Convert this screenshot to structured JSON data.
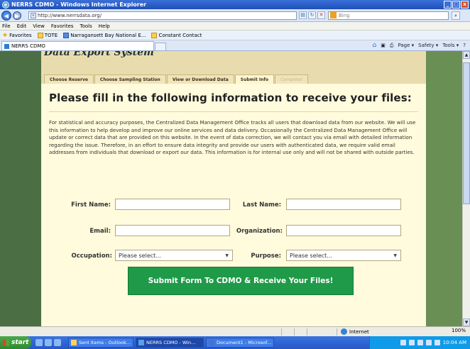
{
  "window": {
    "title": "NERRS CDMO - Windows Internet Explorer",
    "buttons": [
      "_",
      "□",
      "x"
    ]
  },
  "addressbar": {
    "url": "http://www.nerrsdata.org/",
    "search_placeholder": "Bing"
  },
  "menu": [
    "File",
    "Edit",
    "View",
    "Favorites",
    "Tools",
    "Help"
  ],
  "favorites": {
    "label": "Favorites",
    "items": [
      "TOTE",
      "Narragansett Bay National E...",
      "Constant Contact"
    ]
  },
  "browser_tab": {
    "title": "NERRS CDMO"
  },
  "command_bar": [
    "Page ▾",
    "Safety ▾",
    "Tools ▾"
  ],
  "page": {
    "system_header": "Data Export System",
    "steps": [
      {
        "label": "Choose Reserve",
        "state": "done"
      },
      {
        "label": "Choose Sampling Station",
        "state": "done"
      },
      {
        "label": "View or Download Data",
        "state": "done"
      },
      {
        "label": "Submit Info",
        "state": "active"
      },
      {
        "label": "Complete!",
        "state": "disabled"
      }
    ],
    "title": "Please fill in the following information to receive your files:",
    "paragraph": "For statistical and accuracy purposes, the Centralized Data Management Office tracks all users that download data from our website. We will use this information to help develop and improve our online services and data delivery. Occasionally the Centralized Data Management Office will update or correct data that are provided on this website. In the event of data correction, we will contact you via email with detailed information regarding the issue. Therefore, in an effort to ensure data integrity and provide our users with authenticated data, we require valid email addresses from individuals that download or export our data. This information is for internal use only and will not be shared with outside parties.",
    "form": {
      "first_name_label": "First Name:",
      "last_name_label": "Last Name:",
      "email_label": "Email:",
      "organization_label": "Organization:",
      "occupation_label": "Occupation:",
      "occupation_value": "Please select...",
      "purpose_label": "Purpose:",
      "purpose_value": "Please select...",
      "submit_label": "Submit Form To CDMO & Receive Your Files!"
    }
  },
  "statusbar": {
    "zone": "Internet",
    "zoom": "100%"
  },
  "taskbar": {
    "start": "start",
    "items": [
      "Sent Items - Outlook...",
      "NERRS CDMO - Win...",
      "Document1 - Microsof..."
    ],
    "clock": "10:04 AM"
  }
}
